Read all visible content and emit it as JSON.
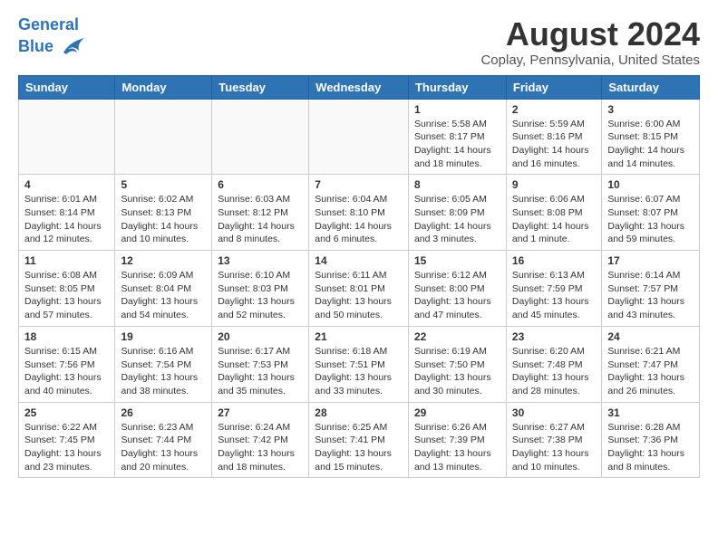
{
  "header": {
    "logo_line1": "General",
    "logo_line2": "Blue",
    "main_title": "August 2024",
    "subtitle": "Coplay, Pennsylvania, United States"
  },
  "weekdays": [
    "Sunday",
    "Monday",
    "Tuesday",
    "Wednesday",
    "Thursday",
    "Friday",
    "Saturday"
  ],
  "weeks": [
    [
      {
        "day": "",
        "info": ""
      },
      {
        "day": "",
        "info": ""
      },
      {
        "day": "",
        "info": ""
      },
      {
        "day": "",
        "info": ""
      },
      {
        "day": "1",
        "info": "Sunrise: 5:58 AM\nSunset: 8:17 PM\nDaylight: 14 hours\nand 18 minutes."
      },
      {
        "day": "2",
        "info": "Sunrise: 5:59 AM\nSunset: 8:16 PM\nDaylight: 14 hours\nand 16 minutes."
      },
      {
        "day": "3",
        "info": "Sunrise: 6:00 AM\nSunset: 8:15 PM\nDaylight: 14 hours\nand 14 minutes."
      }
    ],
    [
      {
        "day": "4",
        "info": "Sunrise: 6:01 AM\nSunset: 8:14 PM\nDaylight: 14 hours\nand 12 minutes."
      },
      {
        "day": "5",
        "info": "Sunrise: 6:02 AM\nSunset: 8:13 PM\nDaylight: 14 hours\nand 10 minutes."
      },
      {
        "day": "6",
        "info": "Sunrise: 6:03 AM\nSunset: 8:12 PM\nDaylight: 14 hours\nand 8 minutes."
      },
      {
        "day": "7",
        "info": "Sunrise: 6:04 AM\nSunset: 8:10 PM\nDaylight: 14 hours\nand 6 minutes."
      },
      {
        "day": "8",
        "info": "Sunrise: 6:05 AM\nSunset: 8:09 PM\nDaylight: 14 hours\nand 3 minutes."
      },
      {
        "day": "9",
        "info": "Sunrise: 6:06 AM\nSunset: 8:08 PM\nDaylight: 14 hours\nand 1 minute."
      },
      {
        "day": "10",
        "info": "Sunrise: 6:07 AM\nSunset: 8:07 PM\nDaylight: 13 hours\nand 59 minutes."
      }
    ],
    [
      {
        "day": "11",
        "info": "Sunrise: 6:08 AM\nSunset: 8:05 PM\nDaylight: 13 hours\nand 57 minutes."
      },
      {
        "day": "12",
        "info": "Sunrise: 6:09 AM\nSunset: 8:04 PM\nDaylight: 13 hours\nand 54 minutes."
      },
      {
        "day": "13",
        "info": "Sunrise: 6:10 AM\nSunset: 8:03 PM\nDaylight: 13 hours\nand 52 minutes."
      },
      {
        "day": "14",
        "info": "Sunrise: 6:11 AM\nSunset: 8:01 PM\nDaylight: 13 hours\nand 50 minutes."
      },
      {
        "day": "15",
        "info": "Sunrise: 6:12 AM\nSunset: 8:00 PM\nDaylight: 13 hours\nand 47 minutes."
      },
      {
        "day": "16",
        "info": "Sunrise: 6:13 AM\nSunset: 7:59 PM\nDaylight: 13 hours\nand 45 minutes."
      },
      {
        "day": "17",
        "info": "Sunrise: 6:14 AM\nSunset: 7:57 PM\nDaylight: 13 hours\nand 43 minutes."
      }
    ],
    [
      {
        "day": "18",
        "info": "Sunrise: 6:15 AM\nSunset: 7:56 PM\nDaylight: 13 hours\nand 40 minutes."
      },
      {
        "day": "19",
        "info": "Sunrise: 6:16 AM\nSunset: 7:54 PM\nDaylight: 13 hours\nand 38 minutes."
      },
      {
        "day": "20",
        "info": "Sunrise: 6:17 AM\nSunset: 7:53 PM\nDaylight: 13 hours\nand 35 minutes."
      },
      {
        "day": "21",
        "info": "Sunrise: 6:18 AM\nSunset: 7:51 PM\nDaylight: 13 hours\nand 33 minutes."
      },
      {
        "day": "22",
        "info": "Sunrise: 6:19 AM\nSunset: 7:50 PM\nDaylight: 13 hours\nand 30 minutes."
      },
      {
        "day": "23",
        "info": "Sunrise: 6:20 AM\nSunset: 7:48 PM\nDaylight: 13 hours\nand 28 minutes."
      },
      {
        "day": "24",
        "info": "Sunrise: 6:21 AM\nSunset: 7:47 PM\nDaylight: 13 hours\nand 26 minutes."
      }
    ],
    [
      {
        "day": "25",
        "info": "Sunrise: 6:22 AM\nSunset: 7:45 PM\nDaylight: 13 hours\nand 23 minutes."
      },
      {
        "day": "26",
        "info": "Sunrise: 6:23 AM\nSunset: 7:44 PM\nDaylight: 13 hours\nand 20 minutes."
      },
      {
        "day": "27",
        "info": "Sunrise: 6:24 AM\nSunset: 7:42 PM\nDaylight: 13 hours\nand 18 minutes."
      },
      {
        "day": "28",
        "info": "Sunrise: 6:25 AM\nSunset: 7:41 PM\nDaylight: 13 hours\nand 15 minutes."
      },
      {
        "day": "29",
        "info": "Sunrise: 6:26 AM\nSunset: 7:39 PM\nDaylight: 13 hours\nand 13 minutes."
      },
      {
        "day": "30",
        "info": "Sunrise: 6:27 AM\nSunset: 7:38 PM\nDaylight: 13 hours\nand 10 minutes."
      },
      {
        "day": "31",
        "info": "Sunrise: 6:28 AM\nSunset: 7:36 PM\nDaylight: 13 hours\nand 8 minutes."
      }
    ]
  ]
}
